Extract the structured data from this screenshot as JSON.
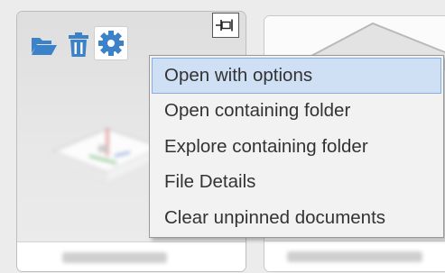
{
  "tiles": [
    {
      "kind": "document-tile",
      "selected": true
    },
    {
      "kind": "document-tile",
      "selected": false
    }
  ],
  "toolbar": {
    "icons": [
      "folder-open-icon",
      "trash-icon",
      "gear-icon",
      "pin-icon"
    ],
    "accent_color": "#3c82c8"
  },
  "context_menu": {
    "highlight_color": "#cfe0f5",
    "items": [
      {
        "label": "Open with options",
        "highlighted": true
      },
      {
        "label": "Open containing folder",
        "highlighted": false
      },
      {
        "label": "Explore containing folder",
        "highlighted": false
      },
      {
        "label": "File Details",
        "highlighted": false
      },
      {
        "label": "Clear unpinned documents",
        "highlighted": false
      }
    ]
  }
}
